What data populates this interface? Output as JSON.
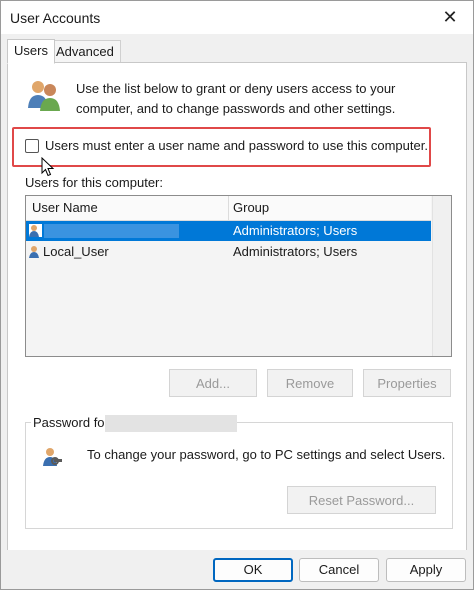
{
  "window": {
    "title": "User Accounts",
    "close_glyph": "✕"
  },
  "tabs": [
    {
      "label": "Users",
      "active": true
    },
    {
      "label": "Advanced",
      "active": false
    }
  ],
  "intro_text": "Use the list below to grant or deny users access to your computer, and to change passwords and other settings.",
  "require_login": {
    "label": "Users must enter a user name and password to use this computer.",
    "checked": false
  },
  "users_section_label": "Users for this computer:",
  "table": {
    "columns": [
      "User Name",
      "Group"
    ],
    "rows": [
      {
        "user_name": "",
        "group": "Administrators; Users",
        "selected": true
      },
      {
        "user_name": "Local_User",
        "group": "Administrators; Users",
        "selected": false
      }
    ]
  },
  "user_buttons": {
    "add": "Add...",
    "remove": "Remove",
    "properties": "Properties"
  },
  "password_group": {
    "legend": "Password for",
    "text": "To change your password, go to PC settings and select Users.",
    "reset_button": "Reset Password..."
  },
  "footer_buttons": {
    "ok": "OK",
    "cancel": "Cancel",
    "apply": "Apply"
  },
  "colors": {
    "selection": "#0078d7",
    "highlight_border": "#e04848",
    "accent": "#0067c0"
  }
}
